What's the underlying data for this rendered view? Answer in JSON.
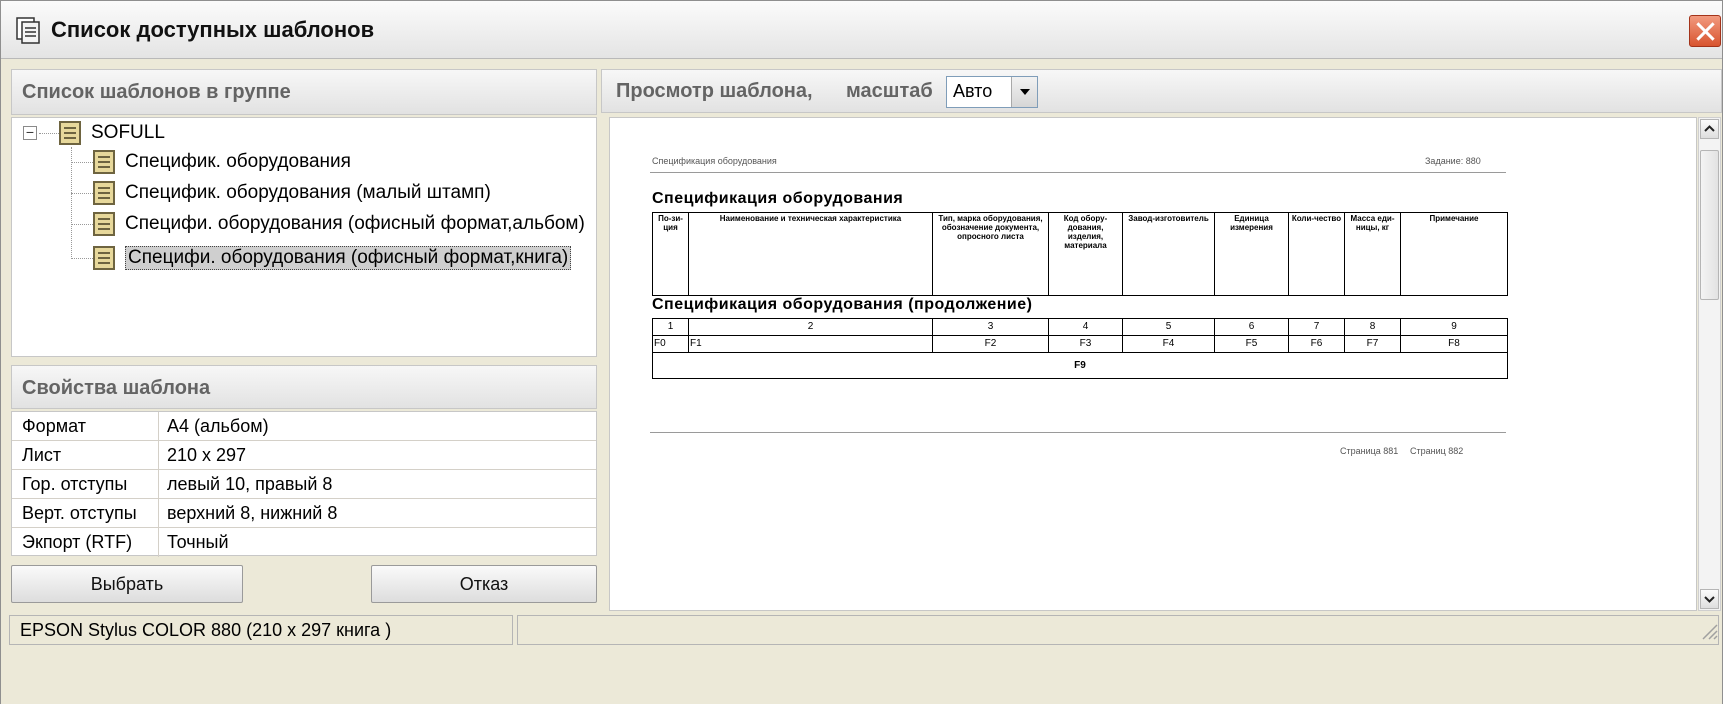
{
  "window": {
    "title": "Список доступных шаблонов"
  },
  "templates_panel": {
    "header": "Список шаблонов в группе",
    "root": {
      "label": "SOFULL",
      "expanded": true
    },
    "items": [
      {
        "label": "Специфик. оборудования",
        "selected": false
      },
      {
        "label": "Специфик. оборудования (малый штамп)",
        "selected": false
      },
      {
        "label": "Специфи. оборудования (офисный формат,альбом)",
        "selected": false
      },
      {
        "label": "Специфи. оборудования (офисный формат,книга)",
        "selected": true
      }
    ]
  },
  "properties_panel": {
    "header": "Свойства шаблона",
    "rows": [
      {
        "key": "Формат",
        "value": "А4 (альбом)"
      },
      {
        "key": "Лист",
        "value": "210 x 297"
      },
      {
        "key": "Гор. отступы",
        "value": "левый 10,  правый 8"
      },
      {
        "key": "Верт. отступы",
        "value": "верхний 8,  нижний 8"
      },
      {
        "key": "Экпорт (RTF)",
        "value": "Точный"
      }
    ]
  },
  "buttons": {
    "select": "Выбрать",
    "cancel": "Отказ"
  },
  "preview": {
    "header": "Просмотр шаблона,",
    "scale_label": "масштаб",
    "scale_value": "Авто",
    "sheet": {
      "header_left": "Спецификация оборудования",
      "header_right": "Задание: 880",
      "title": "Спецификация оборудования",
      "columns": [
        "По-зи-ция",
        "Наименование и техническая характеристика",
        "Тип, марка оборудования, обозначение документа, опросного листа",
        "Код обору-дования, изделия, материала",
        "Завод-изготовитель",
        "Единица измерения",
        "Коли-чество",
        "Масса еди-ницы, кг",
        "Примечание"
      ],
      "continuation_title": "Спецификация оборудования (продолжение)",
      "column_numbers": [
        "1",
        "2",
        "3",
        "4",
        "5",
        "6",
        "7",
        "8",
        "9"
      ],
      "field_codes": [
        "F0",
        "F1",
        "F2",
        "F3",
        "F4",
        "F5",
        "F6",
        "F7",
        "F8"
      ],
      "footer_code": "F9",
      "footer_page": "Страница 881",
      "footer_pages": "Страниц 882"
    }
  },
  "statusbar": {
    "printer": "EPSON Stylus COLOR 880 (210 x 297 книга )",
    "extra": ""
  }
}
